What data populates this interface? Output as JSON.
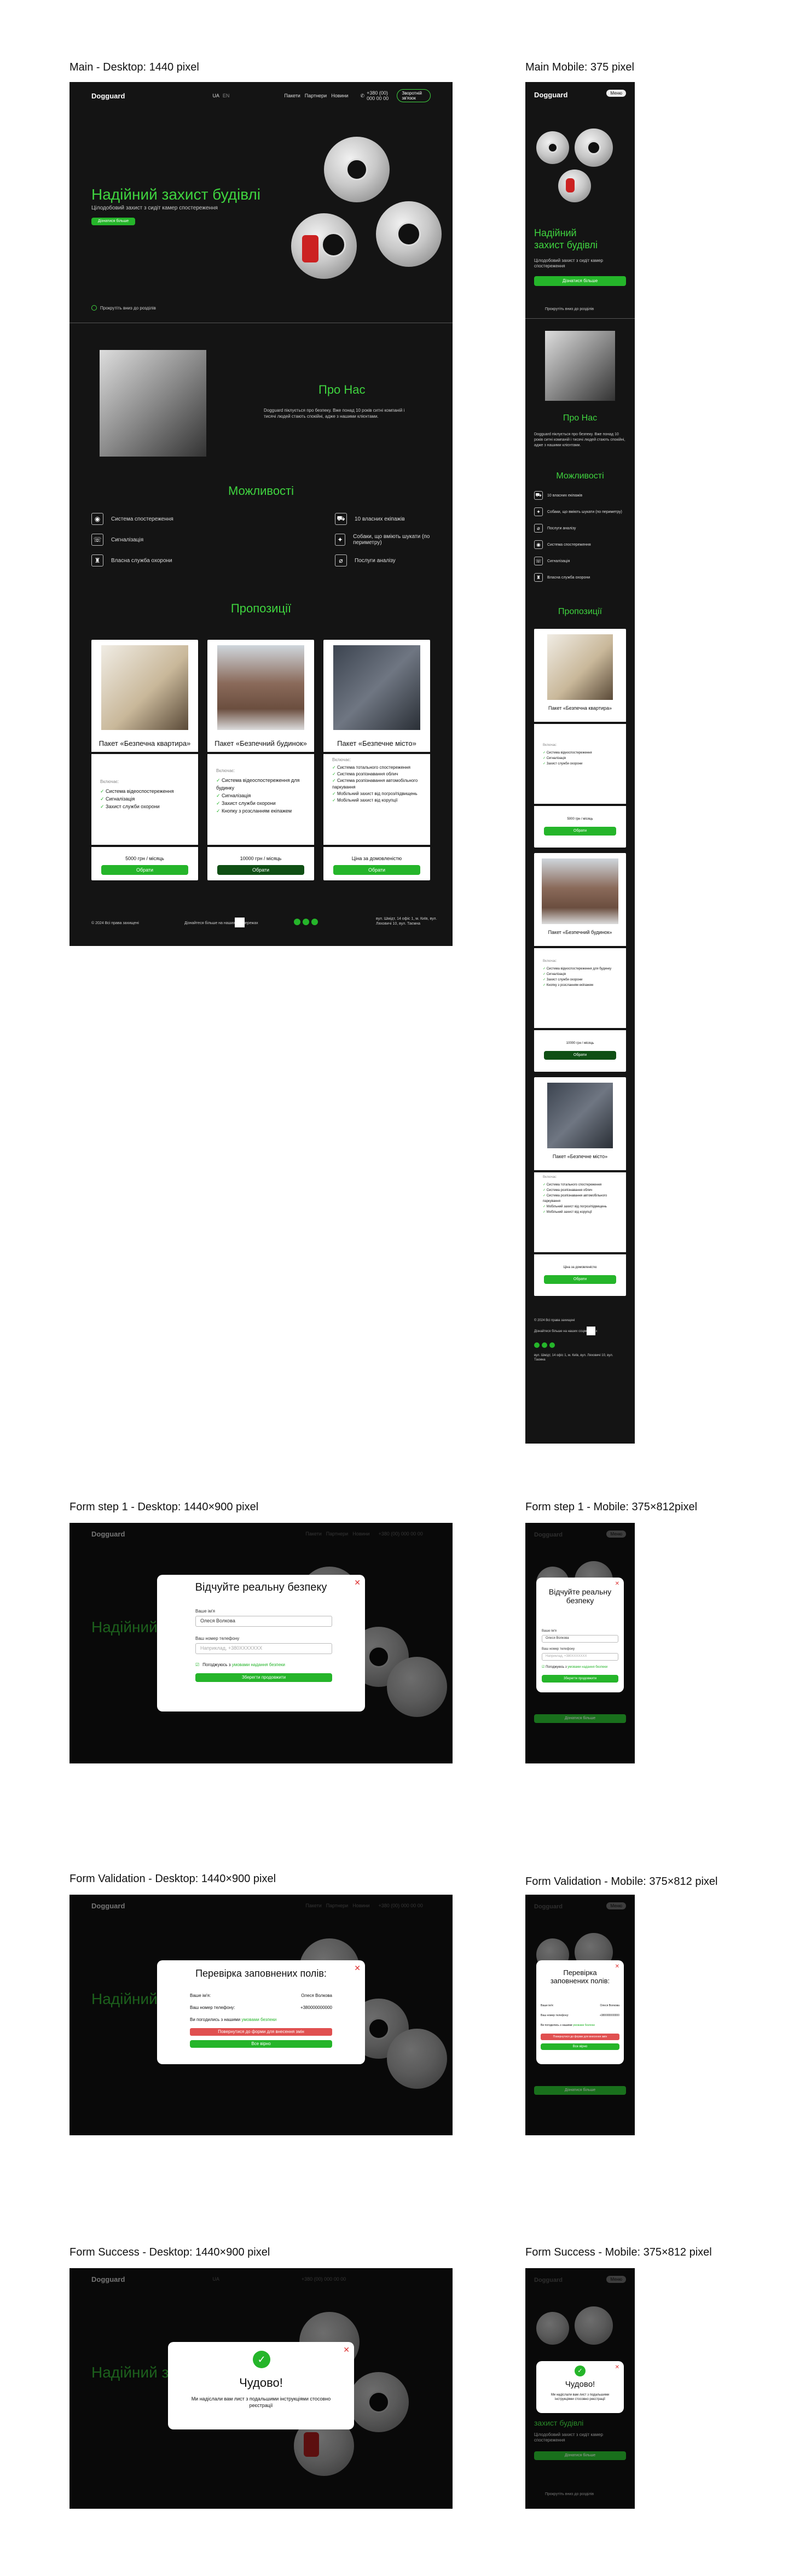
{
  "labels": {
    "main_desktop": "Main - Desktop: 1440 pixel",
    "main_mobile": "Main Mobile: 375 pixel",
    "form1_desktop": "Form step 1 - Desktop: 1440×900 pixel",
    "form1_mobile": "Form step 1 - Mobile: 375×812pixel",
    "valid_desktop": "Form Validation - Desktop: 1440×900 pixel",
    "valid_mobile": "Form Validation - Mobile: 375×812 pixel",
    "success_desktop": "Form Success - Desktop: 1440×900 pixel",
    "success_mobile": "Form Success - Mobile: 375×812 pixel"
  },
  "nav": {
    "logo": "Dogguard",
    "lang_ua": "UA",
    "lang_en": "EN",
    "links": [
      "Пакети",
      "Партнери",
      "Новини"
    ],
    "phone": "+380 (00) 000 00 00",
    "cta": "Зворотній зв'язок",
    "menu": "Меню"
  },
  "hero": {
    "title": "Надійний захист будівлі",
    "title_m1": "Надійний",
    "title_m2": "захист будівлі",
    "subtitle": "Цілодобовий захист з сидіт камер спостереження",
    "cta": "Дізнатися більше",
    "scroll": "Прокрутіть вниз до розділів"
  },
  "about": {
    "title": "Про Нас",
    "text": "Dogguard піклується про безпеку. Вже понад 10 років ситні компаній і тисячі людей стають спокійні, адже з нашими клієнтами."
  },
  "features": {
    "title": "Можливості",
    "left": [
      "Система спостереження",
      "Сигналізація",
      "Власна служба охорони"
    ],
    "right": [
      "10 власних екіпажів",
      "Собаки, що вміють шукати (по периметру)",
      "Послуги аналізу"
    ],
    "left_icons": [
      "camera-icon",
      "alarm-icon",
      "guard-icon"
    ],
    "right_icons": [
      "car-icon",
      "dog-icon",
      "analysis-icon"
    ]
  },
  "offers": {
    "title": "Пропозиції",
    "includes": "Включає:",
    "choose": "Обрати",
    "cards": [
      {
        "title": "Пакет «Безпечна квартира»",
        "items": [
          "Система відеоспостереження",
          "Сигналізація",
          "Захист служби охорони"
        ],
        "price": "5000 грн / місяць"
      },
      {
        "title": "Пакет «Безпечний будинок»",
        "items": [
          "Система відеоспостереження для будинку",
          "Сигналізація",
          "Захист служби охорони",
          "Кнопку з розсланням екіпажем"
        ],
        "price": "10000 грн / місяць"
      },
      {
        "title": "Пакет «Безпечне місто»",
        "items": [
          "Система тотального спостереження",
          "Система розпізнавання облич",
          "Система розпізнавання автомобільного паркування",
          "Мобільний захист від погроз/підвищень",
          "Мобільний захист від корупції"
        ],
        "price": "Ціна за домовленістю"
      }
    ]
  },
  "footer": {
    "copyright": "© 2024 Всі права захищені",
    "subscribe": "Дізнайтеся більше на наших соцмережах",
    "address": "вул. Шмідт, 14 офіс 1, м. Київ, вул. Ляховичі 10, вул. Таємна"
  },
  "form1": {
    "title": "Відчуйте реальну безпеку",
    "title_m": "Відчуйте реальну безпеку",
    "name_label": "Ваше ім'я",
    "name_value": "Олеся Волкова",
    "phone_label": "Ваш номер телефону",
    "phone_placeholder": "Наприклад, +380XXXXXXX",
    "agree": "Погоджуюсь з",
    "agree_link": "умовами надання безпеки",
    "submit": "Зберегти продовжити"
  },
  "validation": {
    "title": "Перевірка заповнених полів:",
    "name_label": "Ваше ім'я:",
    "name_value": "Олеся Волкова",
    "phone_label": "Ваш номер телефону:",
    "phone_value": "+380000000000",
    "agree_label": "Ви погодились з нашими",
    "agree_value": "умовами безпеки",
    "back": "Повернутися до форми для внесення змін",
    "confirm": "Все вірно"
  },
  "success": {
    "title": "Чудово!",
    "text": "Ми надіслали вам лист з подальшими інструкціями стосовно реєстрації"
  },
  "colors": {
    "accent": "#3fd43f",
    "button": "#25b52a",
    "background": "#141414",
    "danger": "#e05050"
  }
}
